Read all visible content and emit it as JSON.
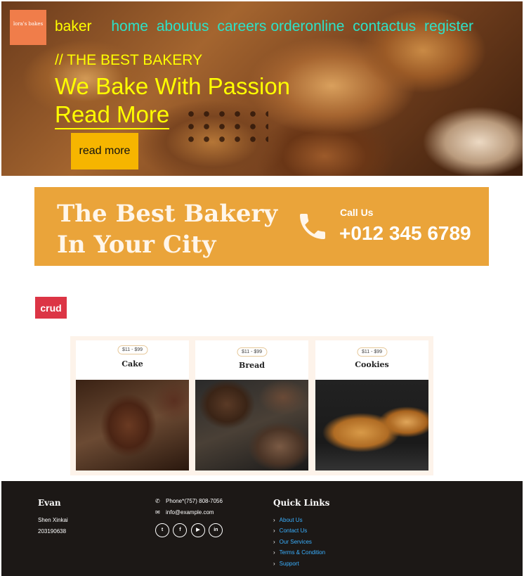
{
  "header": {
    "logo_text": "lora's bakes",
    "brand": "baker",
    "nav": [
      "home",
      "aboutus",
      "careers",
      "orderonline",
      "contactus",
      "register"
    ]
  },
  "hero": {
    "subtitle": "// THE BEST BAKERY",
    "title": "We Bake With Passion",
    "link": "Read More",
    "button": "read more"
  },
  "banner": {
    "title": "The Best Bakery\nIn Your City",
    "call_label": "Call Us",
    "phone": "+012 345 6789"
  },
  "crud_button": "crud",
  "products": [
    {
      "price": "$11 - $99",
      "name": "Cake",
      "image": "cake-photo"
    },
    {
      "price": "$11 - $99",
      "name": "Bread",
      "image": "bread-photo"
    },
    {
      "price": "$11 - $99",
      "name": "Cookies",
      "image": "cookies-photo"
    }
  ],
  "footer": {
    "name": "Evan",
    "line1": "Shen Xinkai",
    "line2": "203190638",
    "phone": "Phone*(757) 808-7056",
    "email": "info@example.com",
    "socials": [
      "twitter-icon",
      "facebook-icon",
      "youtube-icon",
      "linkedin-icon"
    ],
    "quick_links_title": "Quick Links",
    "quick_links": [
      "About Us",
      "Contact Us",
      "Our Services",
      "Terms & Condition",
      "Support"
    ]
  },
  "colors": {
    "brand_yellow": "#ffff00",
    "nav_teal": "#2de2c8",
    "button_yellow": "#f6b500",
    "banner_orange": "#eaa43a",
    "crud_red": "#dc3545",
    "footer_bg": "#1c1816",
    "link_blue": "#3ab0ff"
  }
}
